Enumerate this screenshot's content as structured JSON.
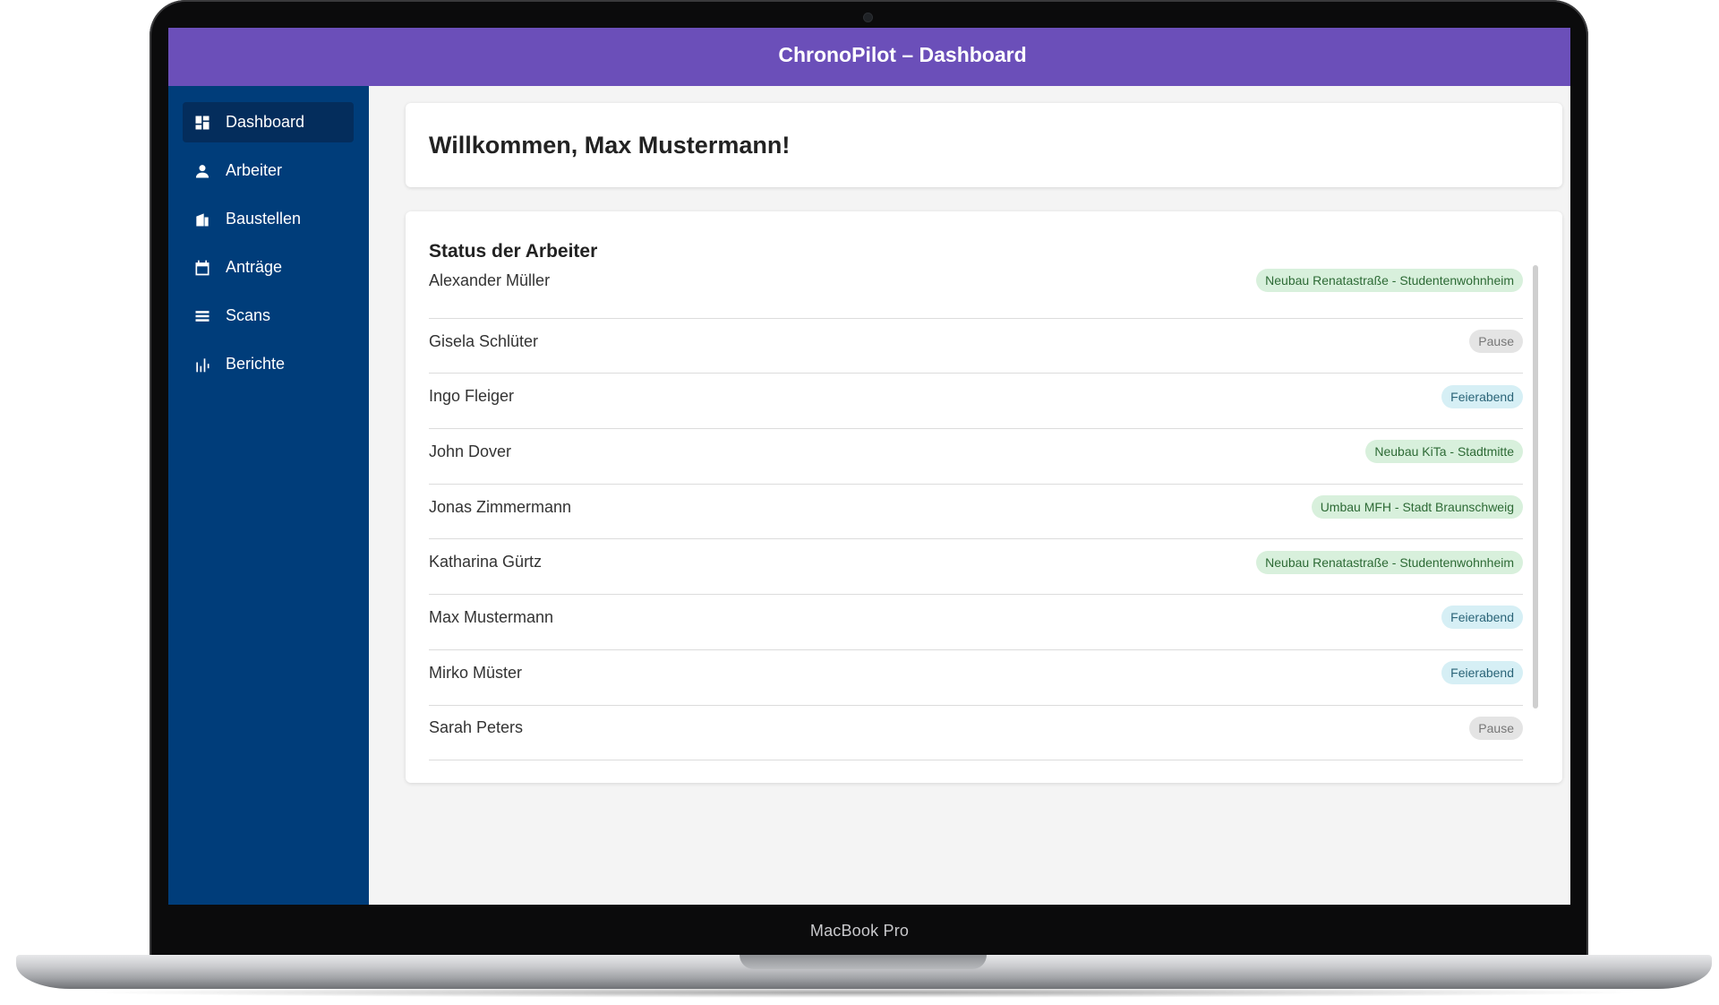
{
  "app": {
    "title": "ChronoPilot – Dashboard"
  },
  "device": {
    "label": "MacBook Pro"
  },
  "sidebar": {
    "items": [
      {
        "label": "Dashboard",
        "icon": "dashboard-icon",
        "active": true
      },
      {
        "label": "Arbeiter",
        "icon": "person-icon",
        "active": false
      },
      {
        "label": "Baustellen",
        "icon": "building-icon",
        "active": false
      },
      {
        "label": "Anträge",
        "icon": "calendar-icon",
        "active": false
      },
      {
        "label": "Scans",
        "icon": "list-icon",
        "active": false
      },
      {
        "label": "Berichte",
        "icon": "bar-chart-icon",
        "active": false
      }
    ]
  },
  "welcome": {
    "title": "Willkommen, Max Mustermann!"
  },
  "status": {
    "title": "Status der Arbeiter",
    "workers": [
      {
        "name": "Alexander Müller",
        "status": "Neubau Renatastraße - Studentenwohnheim",
        "kind": "site"
      },
      {
        "name": "Gisela Schlüter",
        "status": "Pause",
        "kind": "pause"
      },
      {
        "name": "Ingo Fleiger",
        "status": "Feierabend",
        "kind": "end"
      },
      {
        "name": "John Dover",
        "status": "Neubau KiTa - Stadtmitte",
        "kind": "site"
      },
      {
        "name": "Jonas Zimmermann",
        "status": "Umbau MFH - Stadt Braunschweig",
        "kind": "site"
      },
      {
        "name": "Katharina Gürtz",
        "status": "Neubau Renatastraße - Studentenwohnheim",
        "kind": "site"
      },
      {
        "name": "Max Mustermann",
        "status": "Feierabend",
        "kind": "end"
      },
      {
        "name": "Mirko Müster",
        "status": "Feierabend",
        "kind": "end"
      },
      {
        "name": "Sarah Peters",
        "status": "Pause",
        "kind": "pause"
      }
    ]
  },
  "colors": {
    "header": "#6b4fb9",
    "sidebar": "#003d7a",
    "sidebar_active": "#042d5c",
    "badge_site_bg": "#d8f0dc",
    "badge_pause_bg": "#e4e4e4",
    "badge_end_bg": "#d6eff5"
  }
}
